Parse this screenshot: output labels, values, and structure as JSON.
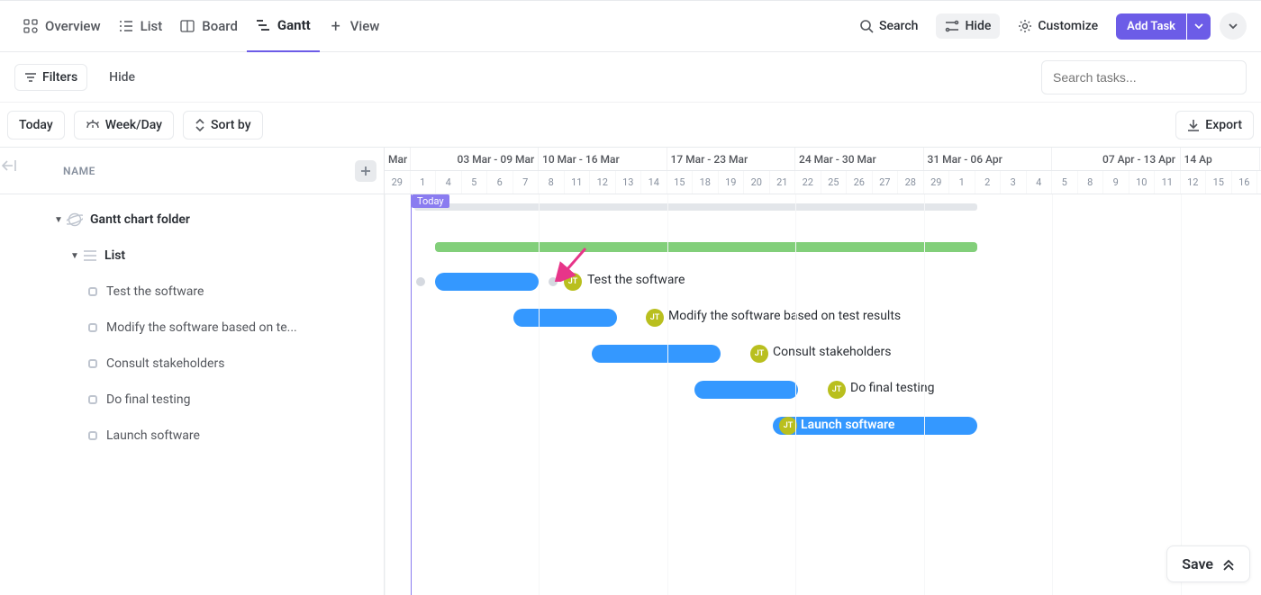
{
  "topbar": {
    "tabs": [
      {
        "label": "Overview"
      },
      {
        "label": "List"
      },
      {
        "label": "Board"
      },
      {
        "label": "Gantt"
      }
    ],
    "add_view": "View",
    "search": "Search",
    "hide": "Hide",
    "customize": "Customize",
    "add_task": "Add Task"
  },
  "row2": {
    "filters": "Filters",
    "hide": "Hide",
    "search_placeholder": "Search tasks..."
  },
  "row3": {
    "today": "Today",
    "zoom": "Week/Day",
    "sort": "Sort by",
    "export": "Export"
  },
  "left": {
    "header": "NAME",
    "folder": "Gantt chart folder",
    "list": "List",
    "tasks": [
      "Test the software",
      "Modify the software based on te...",
      "Consult stakeholders",
      "Do final testing",
      "Launch software"
    ]
  },
  "timeline": {
    "months_prefix": "Mar",
    "weeks": [
      "03 Mar - 09 Mar",
      "10 Mar - 16 Mar",
      "17 Mar - 23 Mar",
      "24 Mar - 30 Mar",
      "31 Mar - 06 Apr",
      "07 Apr - 13 Apr",
      "14 Ap"
    ],
    "days": [
      "29",
      "1",
      "4",
      "5",
      "6",
      "7",
      "8",
      "11",
      "12",
      "13",
      "14",
      "15",
      "18",
      "19",
      "20",
      "21",
      "22",
      "25",
      "26",
      "27",
      "28",
      "29",
      "1",
      "2",
      "3",
      "4",
      "5",
      "8",
      "9",
      "10",
      "11",
      "12",
      "15",
      "16"
    ],
    "today_label": "Today",
    "bars": [
      {
        "label": "Test the software",
        "assignee": "JT"
      },
      {
        "label": "Modify the software based on test results",
        "assignee": "JT"
      },
      {
        "label": "Consult stakeholders",
        "assignee": "JT"
      },
      {
        "label": "Do final testing",
        "assignee": "JT"
      },
      {
        "label": "Launch software",
        "assignee": "JT"
      }
    ]
  },
  "footer": {
    "save": "Save"
  },
  "chart_data": {
    "type": "gantt",
    "time_unit": "day",
    "today": "2025-03-01",
    "tasks": [
      {
        "name": "Test the software",
        "start": "2025-03-02",
        "end": "2025-03-06",
        "assignee": "JT"
      },
      {
        "name": "Modify the software based on test results",
        "start": "2025-03-05",
        "end": "2025-03-09",
        "assignee": "JT"
      },
      {
        "name": "Consult stakeholders",
        "start": "2025-03-10",
        "end": "2025-03-15",
        "assignee": "JT"
      },
      {
        "name": "Do final testing",
        "start": "2025-03-15",
        "end": "2025-03-19",
        "assignee": "JT"
      },
      {
        "name": "Launch software",
        "start": "2025-03-19",
        "end": "2025-04-01",
        "assignee": "JT"
      }
    ],
    "summary_bar": {
      "start": "2025-03-02",
      "end": "2025-04-01",
      "color": "#82cf7a"
    }
  }
}
